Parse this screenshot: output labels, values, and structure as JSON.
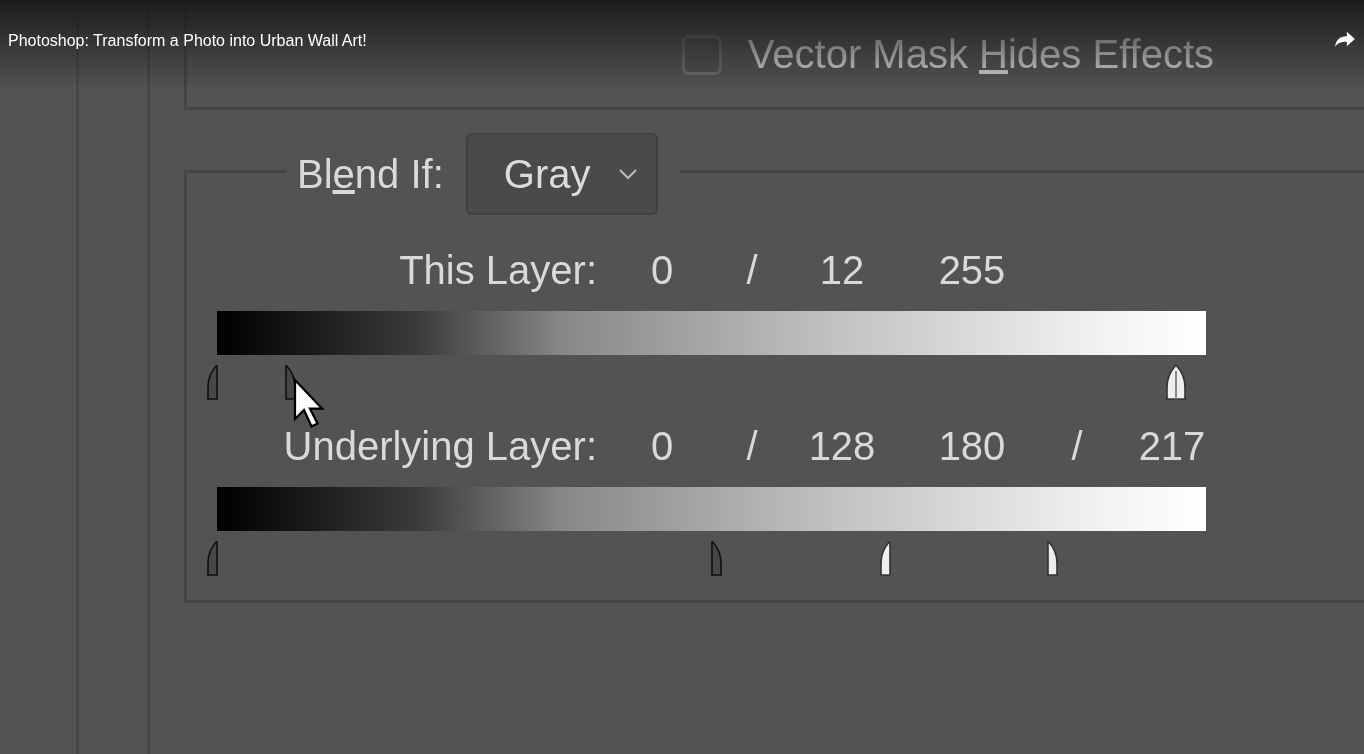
{
  "video": {
    "title": "Photoshop: Transform a Photo into Urban Wall Art!"
  },
  "vector_mask": {
    "label_before": "Vector Mask ",
    "mnemonic": "H",
    "label_after": "ides Effects",
    "checked": false
  },
  "blend_if": {
    "label_before": "Bl",
    "mnemonic": "e",
    "label_after": "nd If:",
    "dropdown": {
      "value": "Gray"
    }
  },
  "rows": [
    {
      "label": "This Layer:",
      "values": [
        "0",
        "/",
        "12",
        "255"
      ],
      "handles": [
        {
          "kind": "left-half",
          "light": false,
          "level": 0.0
        },
        {
          "kind": "right-half",
          "light": false,
          "level": 0.07
        },
        {
          "kind": "full",
          "light": true,
          "level": 0.97
        }
      ]
    },
    {
      "label": "Underlying Layer:",
      "values": [
        "0",
        "/",
        "128",
        "180",
        "/",
        "217"
      ],
      "handles": [
        {
          "kind": "left-half",
          "light": false,
          "level": 0.0
        },
        {
          "kind": "right-half",
          "light": false,
          "level": 0.5
        },
        {
          "kind": "left-half",
          "light": true,
          "level": 0.68
        },
        {
          "kind": "right-half",
          "light": true,
          "level": 0.84
        }
      ]
    }
  ]
}
